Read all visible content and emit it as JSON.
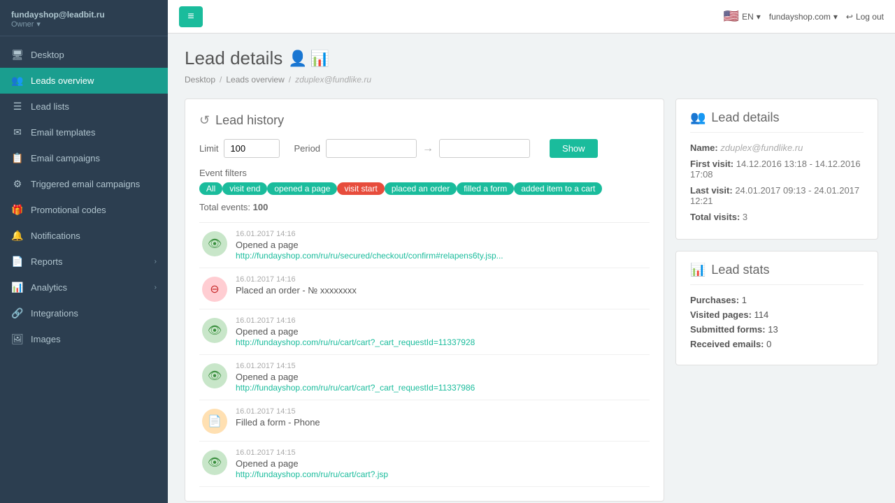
{
  "sidebar": {
    "username": "fundayshop@leadbit.ru",
    "role": "Owner",
    "items": [
      {
        "id": "desktop",
        "label": "Desktop",
        "icon": "🖥",
        "active": false
      },
      {
        "id": "leads-overview",
        "label": "Leads overview",
        "icon": "👥",
        "active": true
      },
      {
        "id": "lead-lists",
        "label": "Lead lists",
        "icon": "☰",
        "active": false
      },
      {
        "id": "email-templates",
        "label": "Email templates",
        "icon": "✉",
        "active": false
      },
      {
        "id": "email-campaigns",
        "label": "Email campaigns",
        "icon": "📋",
        "active": false
      },
      {
        "id": "triggered-campaigns",
        "label": "Triggered email campaigns",
        "icon": "⚙",
        "active": false
      },
      {
        "id": "promo-codes",
        "label": "Promotional codes",
        "icon": "🎁",
        "active": false
      },
      {
        "id": "notifications",
        "label": "Notifications",
        "icon": "🔔",
        "active": false
      },
      {
        "id": "reports",
        "label": "Reports",
        "icon": "📄",
        "active": false,
        "hasChevron": true
      },
      {
        "id": "analytics",
        "label": "Analytics",
        "icon": "📊",
        "active": false,
        "hasChevron": true
      },
      {
        "id": "integrations",
        "label": "Integrations",
        "icon": "🔗",
        "active": false
      },
      {
        "id": "images",
        "label": "Images",
        "icon": "🖼",
        "active": false
      }
    ]
  },
  "topbar": {
    "menu_icon": "≡",
    "flag_label": "EN",
    "domain": "fundayshop.com",
    "logout_label": "Log out"
  },
  "breadcrumb": {
    "desktop": "Desktop",
    "leads_overview": "Leads overview",
    "current": "zduplex@fundlike.ru"
  },
  "page": {
    "title": "Lead details"
  },
  "lead_history": {
    "section_title": "Lead history",
    "limit_label": "Limit",
    "limit_value": "100",
    "period_label": "Period",
    "show_button": "Show",
    "event_filters_label": "Event filters",
    "filters": [
      {
        "id": "all",
        "label": "All",
        "class": "tag-all"
      },
      {
        "id": "visit-end",
        "label": "visit end",
        "class": "tag-visit-end"
      },
      {
        "id": "opened-page",
        "label": "opened a page",
        "class": "tag-opened-page"
      },
      {
        "id": "visit-start",
        "label": "visit start",
        "class": "tag-visit-start"
      },
      {
        "id": "placed-order",
        "label": "placed an order",
        "class": "tag-placed-order"
      },
      {
        "id": "filled-form",
        "label": "filled a form",
        "class": "tag-filled-form"
      },
      {
        "id": "added-cart",
        "label": "added item to a cart",
        "class": "tag-added-cart"
      }
    ],
    "total_events_label": "Total events:",
    "total_events_value": "100",
    "events": [
      {
        "icon": "eye",
        "icon_class": "event-icon-green",
        "time": "16.01.2017 14:16",
        "text": "Opened a page",
        "link": "http://fundayshop.com/ru/ru/secured/checkout/confirm#relapens6ty.jsp...",
        "type": "opened-page"
      },
      {
        "icon": "order",
        "icon_class": "event-icon-red",
        "time": "16.01.2017 14:16",
        "text": "Placed an order - № xxxxxxxx",
        "link": "",
        "type": "placed-order"
      },
      {
        "icon": "eye",
        "icon_class": "event-icon-green",
        "time": "16.01.2017 14:16",
        "text": "Opened a page",
        "link": "http://fundayshop.com/ru/ru/cart/cart?_cart_requestId=11337928",
        "type": "opened-page"
      },
      {
        "icon": "eye",
        "icon_class": "event-icon-green",
        "time": "16.01.2017 14:15",
        "text": "Opened a page",
        "link": "http://fundayshop.com/ru/ru/cart/cart?_cart_requestId=11337986",
        "type": "opened-page"
      },
      {
        "icon": "form",
        "icon_class": "event-icon-orange",
        "time": "16.01.2017 14:15",
        "text": "Filled a form - Phone",
        "link": "",
        "type": "filled-form"
      },
      {
        "icon": "eye",
        "icon_class": "event-icon-green",
        "time": "16.01.2017 14:15",
        "text": "Opened a page",
        "link": "http://fundayshop.com/ru/ru/cart/cart?.jsp",
        "type": "opened-page"
      }
    ]
  },
  "lead_details": {
    "section_title": "Lead details",
    "name_label": "Name:",
    "name_value": "zduplex@fundlike.ru",
    "first_visit_label": "First visit:",
    "first_visit_value": "14.12.2016 13:18 - 14.12.2016 17:08",
    "last_visit_label": "Last visit:",
    "last_visit_value": "24.01.2017 09:13 - 24.01.2017 12:21",
    "total_visits_label": "Total visits:",
    "total_visits_value": "3"
  },
  "lead_stats": {
    "section_title": "Lead stats",
    "purchases_label": "Purchases:",
    "purchases_value": "1",
    "visited_pages_label": "Visited pages:",
    "visited_pages_value": "114",
    "submitted_forms_label": "Submitted forms:",
    "submitted_forms_value": "13",
    "received_emails_label": "Received emails:",
    "received_emails_value": "0"
  }
}
